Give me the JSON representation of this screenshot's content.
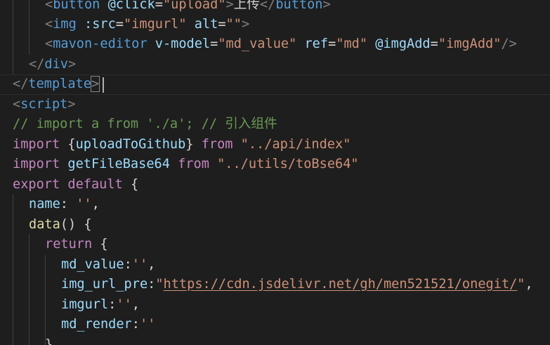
{
  "code": {
    "line0": [
      "<",
      "button",
      "@click",
      "=",
      "\"upload\"",
      ">",
      "上传",
      "</",
      "button",
      ">"
    ],
    "line1": [
      "<",
      "img",
      ":src",
      "=",
      "\"imgurl\"",
      "alt",
      "=",
      "\"\"",
      ">"
    ],
    "line2": [
      "<",
      "mavon-editor",
      "v-model",
      "=",
      "\"md_value\"",
      "ref",
      "=",
      "\"md\"",
      "@imgAdd",
      "=",
      "\"imgAdd\"",
      "/>"
    ],
    "line3": [
      "</",
      "div",
      ">"
    ],
    "line4": [
      "</",
      "template",
      ">"
    ],
    "line5": [
      "<",
      "script",
      ">"
    ],
    "line6": "// import a from './a'; // 引入组件",
    "line7": [
      "import",
      " {",
      "uploadToGithub",
      "} ",
      "from",
      "\"../api/index\""
    ],
    "line8": [
      "import",
      "getFileBase64",
      "from",
      "\"../utils/toBse64\""
    ],
    "line9": [
      "export",
      "default",
      "{"
    ],
    "line10": [
      "name",
      ":",
      "''",
      ","
    ],
    "line11": [
      "data",
      "()",
      "{"
    ],
    "line12": [
      "return",
      "{"
    ],
    "line13": [
      "md_value",
      ":",
      "''",
      ","
    ],
    "line14": [
      "img_url_pre",
      ":",
      "\"",
      "https://cdn.jsdelivr.net/gh/men521521/onegit/",
      "\"",
      ","
    ],
    "line15": [
      "imgurl",
      ":",
      "''",
      ","
    ],
    "line16": [
      "md_render",
      ":",
      "''"
    ],
    "line17": [
      "}"
    ]
  }
}
